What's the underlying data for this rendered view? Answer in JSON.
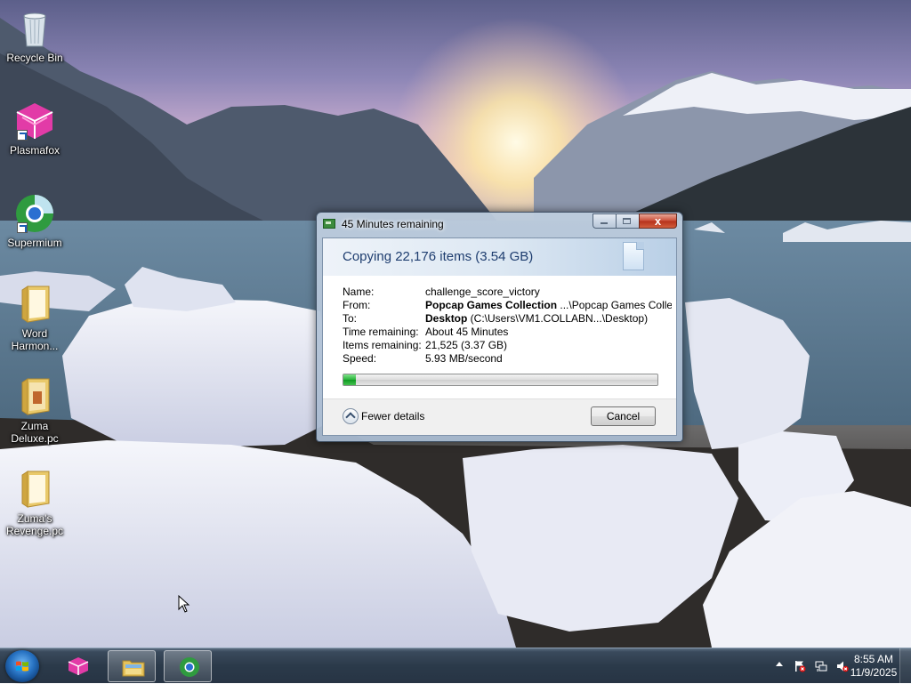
{
  "desktop": {
    "icons": [
      {
        "label": "Recycle Bin",
        "icon": "recycle-bin-icon"
      },
      {
        "label": "Plasmafox",
        "icon": "plasmafox-icon"
      },
      {
        "label": "Supermium",
        "icon": "supermium-icon"
      },
      {
        "label_lines": [
          "Word",
          "Harmon..."
        ],
        "icon": "folder-icon"
      },
      {
        "label_lines": [
          "Zuma",
          "Deluxe.pc"
        ],
        "icon": "folder-icon"
      },
      {
        "label_lines": [
          "Zuma's",
          "Revenge.pc"
        ],
        "icon": "folder-icon"
      }
    ]
  },
  "dialog": {
    "title": "45 Minutes remaining",
    "heading": "Copying 22,176 items (3.54 GB)",
    "details": {
      "name_label": "Name:",
      "name_value": "challenge_score_victory",
      "from_label": "From:",
      "from_bold": "Popcap Games Collection",
      "from_path": " ...\\Popcap Games Colle",
      "to_label": "To:",
      "to_bold": "Desktop",
      "to_path": " (C:\\Users\\VM1.COLLABN...\\Desktop)",
      "time_label": "Time remaining:",
      "time_value": "About 45 Minutes",
      "items_label": "Items remaining:",
      "items_value": "21,525 (3.37 GB)",
      "speed_label": "Speed:",
      "speed_value": "5.93 MB/second"
    },
    "progress": 0.04,
    "fewer_details_label": "Fewer details",
    "cancel_label": "Cancel",
    "close_glyph": "x"
  },
  "taskbar": {
    "pinned": [
      {
        "icon": "plasmafox-icon",
        "active": false
      },
      {
        "icon": "file-explorer-icon",
        "active": true
      },
      {
        "icon": "supermium-icon",
        "active": true
      }
    ],
    "tray_icons": [
      "action-center-flag-icon",
      "network-icon",
      "volume-muted-icon"
    ],
    "clock": {
      "time": "8:55 AM",
      "date": "11/9/2025"
    }
  },
  "colors": {
    "progress_fill": "#28b13a",
    "heading_text": "#1e3d6f",
    "taskbar": "#2b3a4a"
  }
}
